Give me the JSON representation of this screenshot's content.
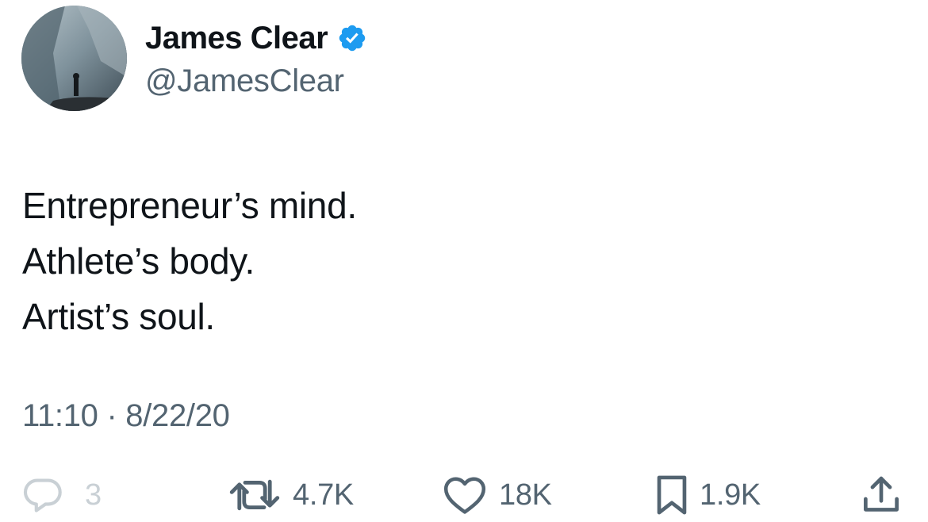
{
  "author": {
    "display_name": "James Clear",
    "handle": "@JamesClear",
    "verified": true,
    "avatar_icon": "avatar-photo",
    "verified_icon": "verified-badge-icon",
    "verified_color": "#1d9bf0"
  },
  "tweet": {
    "lines": [
      "Entrepreneur’s mind.",
      "Athlete’s body.",
      "Artist’s soul."
    ],
    "timestamp": "11:10 · 8/22/20"
  },
  "actions": {
    "reply": {
      "icon": "reply-icon",
      "count": "3"
    },
    "retweet": {
      "icon": "retweet-icon",
      "count": "4.7K"
    },
    "like": {
      "icon": "heart-icon",
      "count": "18K"
    },
    "bookmark": {
      "icon": "bookmark-icon",
      "count": "1.9K"
    },
    "share": {
      "icon": "share-icon"
    }
  },
  "colors": {
    "text_primary": "#0f1419",
    "text_secondary": "#536471",
    "muted": "#c9d0d5",
    "accent": "#1d9bf0"
  }
}
